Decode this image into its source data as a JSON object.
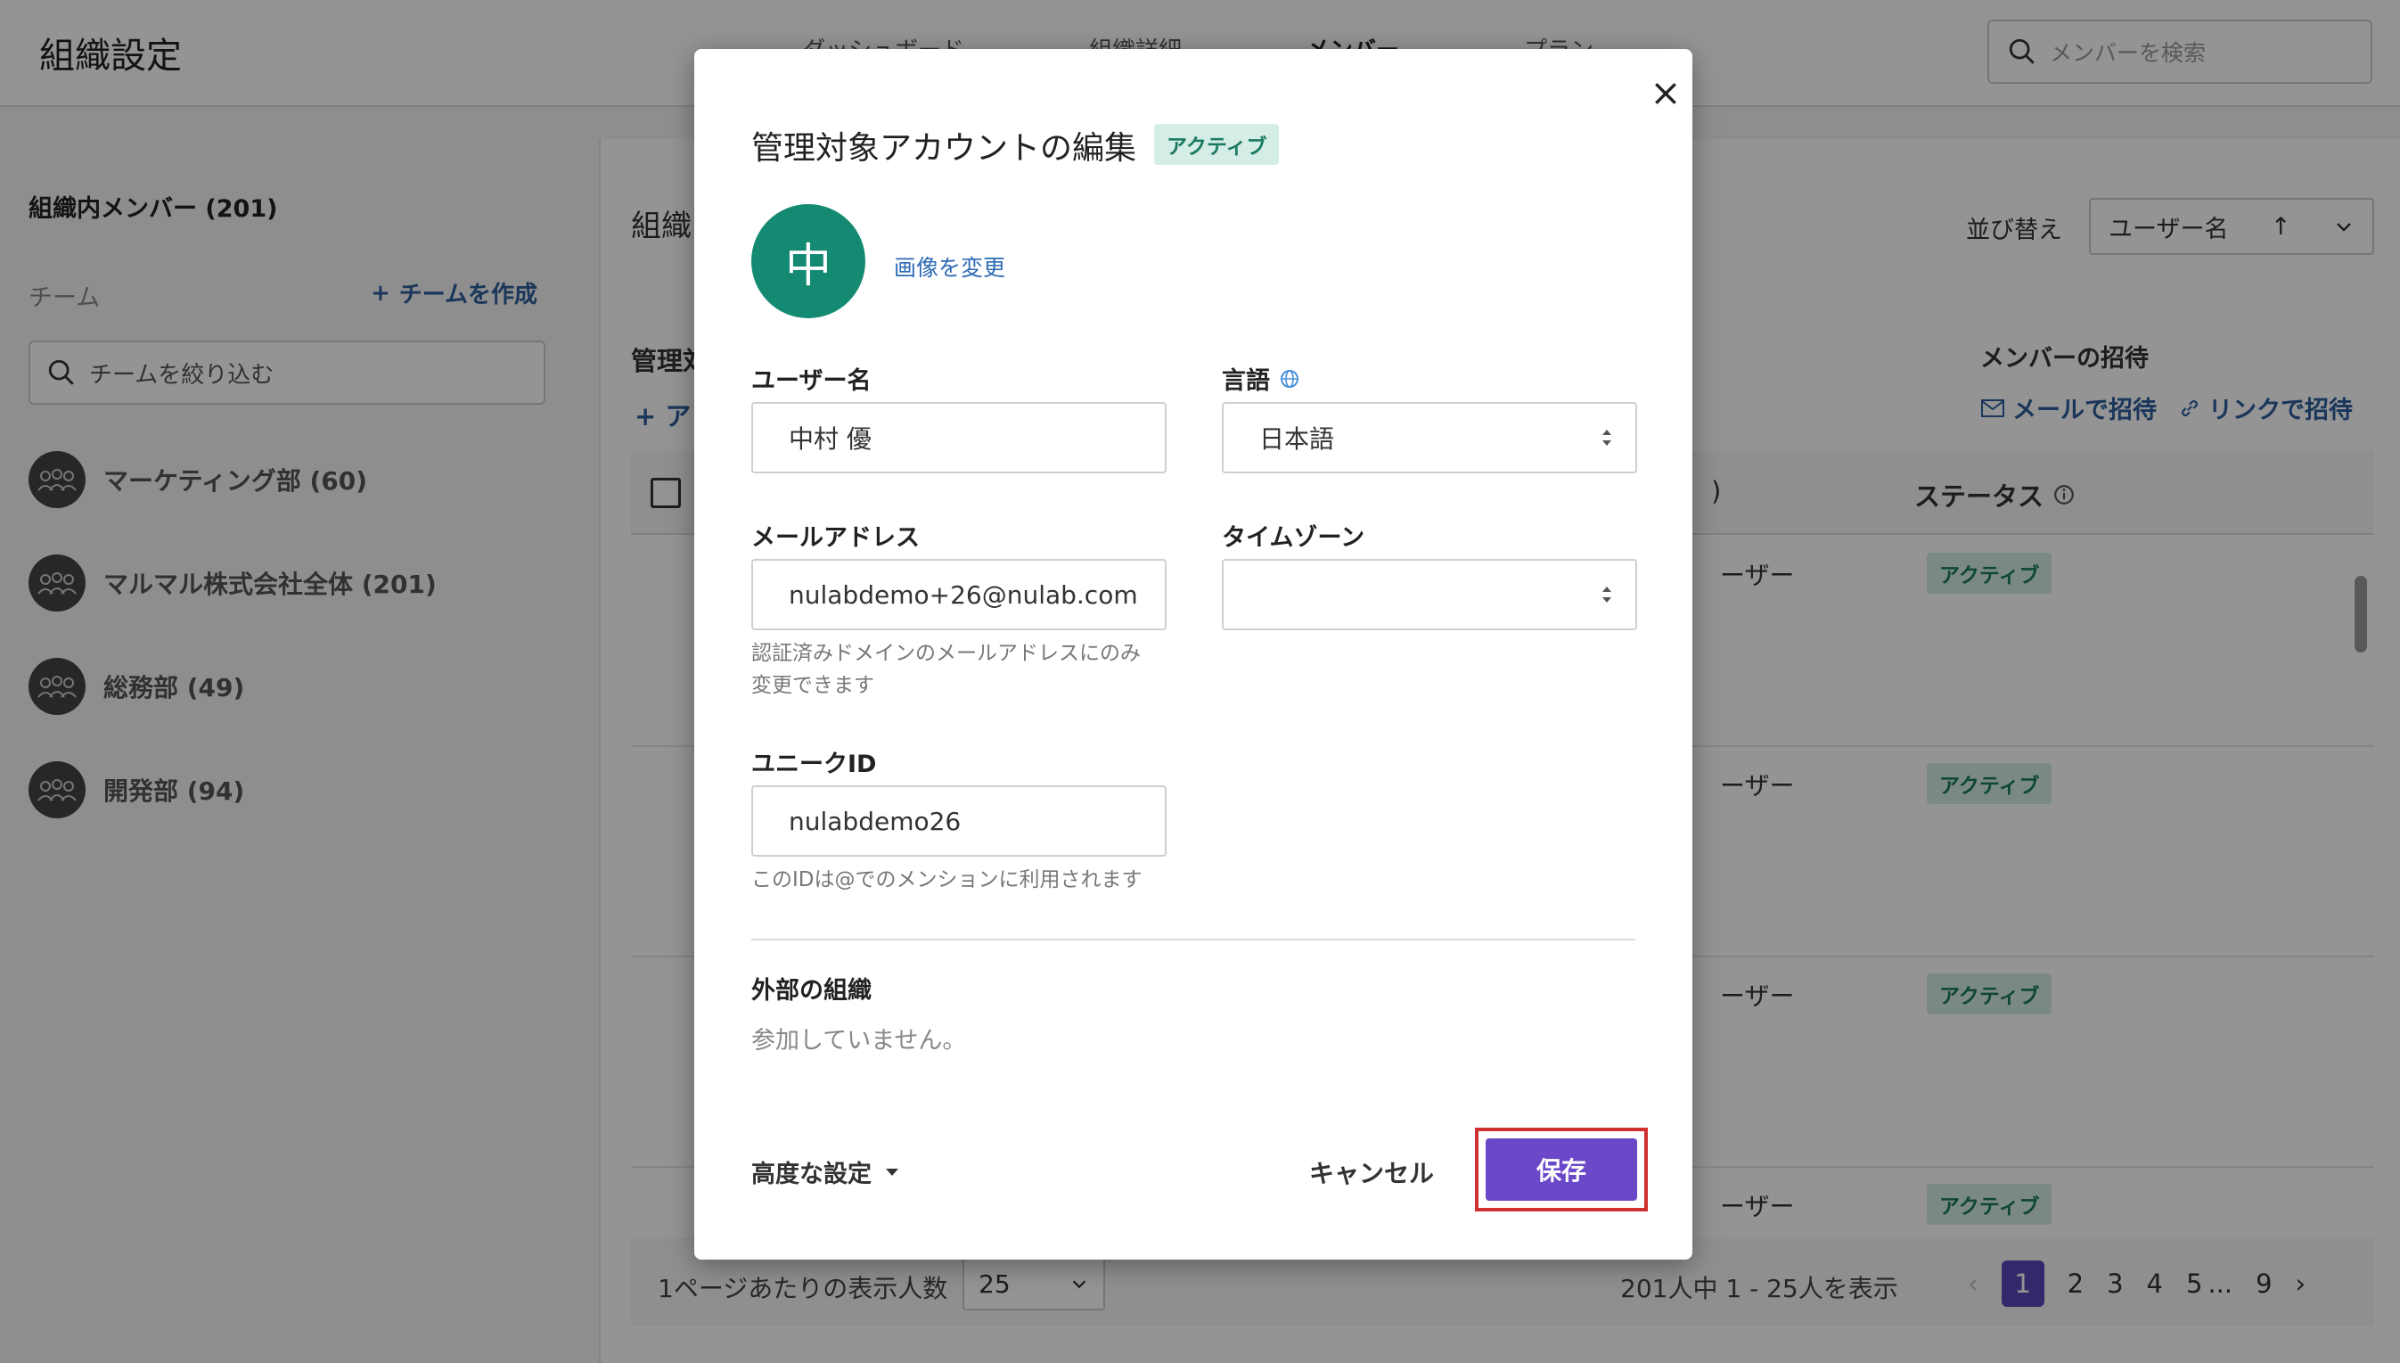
{
  "app": {
    "title": "組織設定",
    "nav_tabs": [
      "ダッシュボード",
      "組織詳細",
      "メンバー",
      "プラン"
    ],
    "search_placeholder": "メンバーを検索"
  },
  "sidebar": {
    "heading": "組織内メンバー (201)",
    "team_label": "チーム",
    "create_team": "チームを作成",
    "filter_placeholder": "チームを絞り込む",
    "teams": [
      {
        "label": "マーケティング部 (60)"
      },
      {
        "label": "マルマル株式会社全体 (201)"
      },
      {
        "label": "総務部 (49)"
      },
      {
        "label": "開発部 (94)"
      }
    ]
  },
  "main": {
    "title": "組織",
    "sort_label": "並び替え",
    "sort_value": "ユーザー名",
    "managed_label": "管理対",
    "add_link": "+ ア",
    "invite_label": "メンバーの招待",
    "invite_email": "メールで招待",
    "invite_link": "リンクで招待",
    "table": {
      "paren": ")",
      "status_header": "ステータス",
      "rows": [
        {
          "role": "ーザー",
          "status": "アクティブ"
        },
        {
          "role": "ーザー",
          "status": "アクティブ"
        },
        {
          "role": "ーザー",
          "status": "アクティブ"
        },
        {
          "role": "ーザー",
          "status": "アクティブ"
        }
      ]
    },
    "footer": {
      "per_page_label": "1ページあたりの表示人数",
      "per_page_value": "25",
      "range_text": "201人中 1 - 25人を表示",
      "pages": [
        "1",
        "2",
        "3",
        "4",
        "5"
      ],
      "ellipsis": "...",
      "last_page": "9"
    }
  },
  "modal": {
    "title": "管理対象アカウントの編集",
    "status_badge": "アクティブ",
    "avatar_initial": "中",
    "change_image": "画像を変更",
    "username_label": "ユーザー名",
    "username_value": "中村 優",
    "language_label": "言語",
    "language_value": "日本語",
    "email_label": "メールアドレス",
    "email_value": "nulabdemo+26@nulab.com",
    "email_help_1": "認証済みドメインのメールアドレスにのみ",
    "email_help_2": "変更できます",
    "timezone_label": "タイムゾーン",
    "timezone_value": "",
    "unique_id_label": "ユニークID",
    "unique_id_value": "nulabdemo26",
    "unique_id_help": "このIDは@でのメンションに利用されます",
    "external_org_label": "外部の組織",
    "external_org_text": "参加していません。",
    "advanced_settings": "高度な設定",
    "cancel": "キャンセル",
    "save": "保存"
  },
  "colors": {
    "primary_button": "#6a48c8",
    "avatar_bg": "#158a73",
    "badge_bg": "#d4ede6",
    "badge_text": "#1b7a5e",
    "link": "#2e6bb5",
    "highlight_box": "#d03030"
  }
}
